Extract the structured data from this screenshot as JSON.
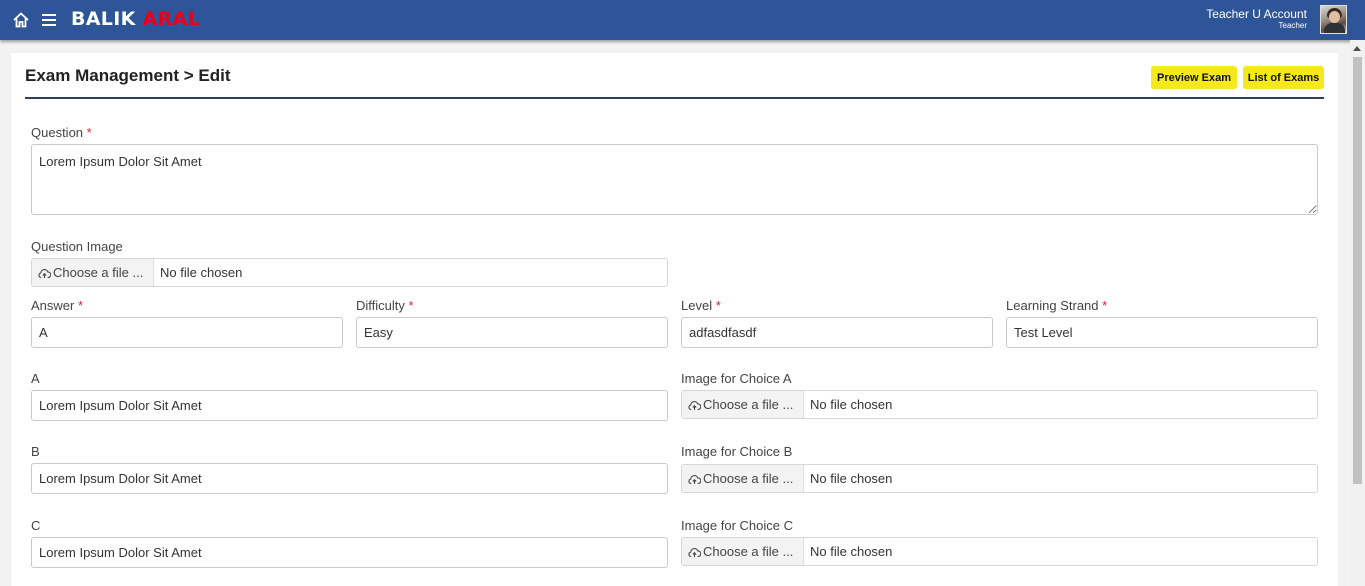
{
  "brand": {
    "part1": "BALIK",
    "part2": "ARAL"
  },
  "user": {
    "name": "Teacher U Account",
    "role": "Teacher"
  },
  "page": {
    "title": "Exam Management > Edit",
    "preview_label": "Preview Exam",
    "list_label": "List of Exams"
  },
  "form": {
    "question": {
      "label": "Question",
      "value": "Lorem Ipsum Dolor Sit Amet"
    },
    "question_image": {
      "label": "Question Image"
    },
    "answer": {
      "label": "Answer",
      "value": "A"
    },
    "difficulty": {
      "label": "Difficulty",
      "value": "Easy"
    },
    "level": {
      "label": "Level",
      "value": "adfasdfasdf"
    },
    "strand": {
      "label": "Learning Strand",
      "value": "Test Level"
    },
    "required_mark": "*",
    "choices": [
      {
        "label": "A",
        "value": "Lorem Ipsum Dolor Sit Amet",
        "image_label": "Image for Choice A"
      },
      {
        "label": "B",
        "value": "Lorem Ipsum Dolor Sit Amet",
        "image_label": "Image for Choice B"
      },
      {
        "label": "C",
        "value": "Lorem Ipsum Dolor Sit Amet",
        "image_label": "Image for Choice C"
      }
    ],
    "file_button": "Choose a file ...",
    "no_file": "No file chosen"
  },
  "colors": {
    "topbar": "#2e5598",
    "brand_accent": "#e8001a",
    "button": "#f5e81c",
    "required": "#e0242c"
  }
}
